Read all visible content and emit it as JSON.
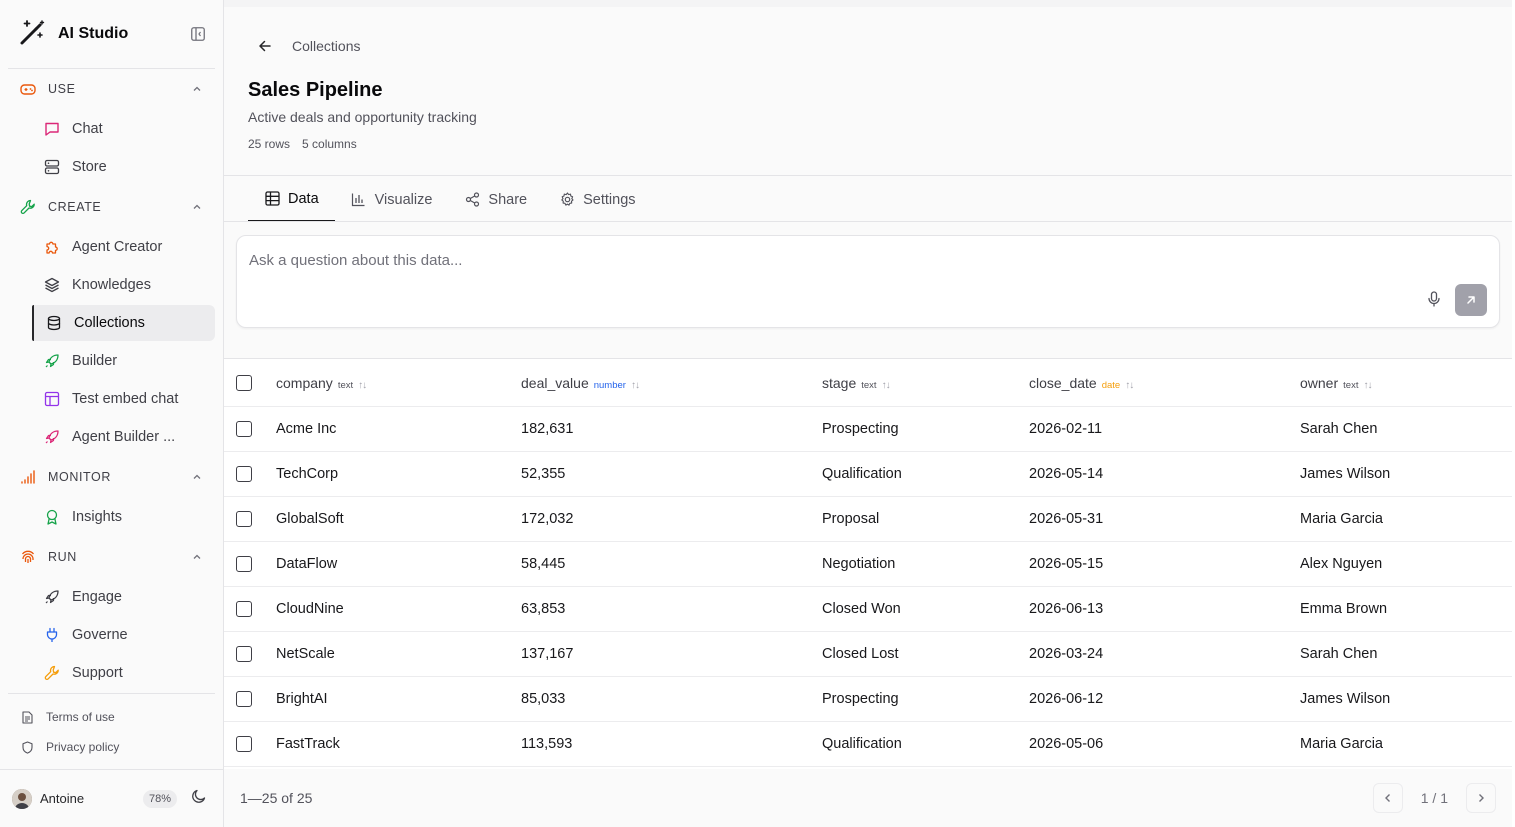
{
  "app": {
    "name": "AI Studio"
  },
  "colors": {
    "orange": "#ea580c",
    "green": "#16a34a",
    "pink": "#db2777",
    "purple": "#9333ea",
    "blue": "#2563eb",
    "amber": "#f59e0b"
  },
  "sidebar": {
    "sections": [
      {
        "label": "USE",
        "items": [
          {
            "label": "Chat",
            "icon": "message-square-icon"
          },
          {
            "label": "Store",
            "icon": "server-icon"
          }
        ]
      },
      {
        "label": "CREATE",
        "items": [
          {
            "label": "Agent Creator",
            "icon": "puzzle-icon"
          },
          {
            "label": "Knowledges",
            "icon": "layers-icon"
          },
          {
            "label": "Collections",
            "icon": "database-icon",
            "active": true
          },
          {
            "label": "Builder",
            "icon": "rocket-icon"
          },
          {
            "label": "Test embed chat",
            "icon": "layout-icon"
          },
          {
            "label": "Agent Builder ...",
            "icon": "rocket-icon"
          }
        ]
      },
      {
        "label": "MONITOR",
        "items": [
          {
            "label": "Insights",
            "icon": "award-icon"
          }
        ]
      },
      {
        "label": "RUN",
        "items": [
          {
            "label": "Engage",
            "icon": "rocket-icon"
          },
          {
            "label": "Governe",
            "icon": "plug-icon"
          },
          {
            "label": "Support",
            "icon": "wrench-icon"
          }
        ]
      }
    ],
    "legal": {
      "terms": "Terms of use",
      "privacy": "Privacy policy"
    },
    "user": {
      "name": "Antoine",
      "usage": "78%"
    }
  },
  "header": {
    "breadcrumb": "Collections",
    "title": "Sales Pipeline",
    "subtitle": "Active deals and opportunity tracking",
    "rows": "25 rows",
    "columns": "5 columns"
  },
  "tabs": [
    {
      "label": "Data",
      "icon": "table-icon"
    },
    {
      "label": "Visualize",
      "icon": "bar-chart-icon"
    },
    {
      "label": "Share",
      "icon": "share-icon"
    },
    {
      "label": "Settings",
      "icon": "gear-icon"
    }
  ],
  "ask": {
    "placeholder": "Ask a question about this data..."
  },
  "table": {
    "columns": [
      {
        "name": "company",
        "type": "text"
      },
      {
        "name": "deal_value",
        "type": "number"
      },
      {
        "name": "stage",
        "type": "text"
      },
      {
        "name": "close_date",
        "type": "date"
      },
      {
        "name": "owner",
        "type": "text"
      }
    ],
    "rows": [
      [
        "Acme Inc",
        "182,631",
        "Prospecting",
        "2026-02-11",
        "Sarah Chen"
      ],
      [
        "TechCorp",
        "52,355",
        "Qualification",
        "2026-05-14",
        "James Wilson"
      ],
      [
        "GlobalSoft",
        "172,032",
        "Proposal",
        "2026-05-31",
        "Maria Garcia"
      ],
      [
        "DataFlow",
        "58,445",
        "Negotiation",
        "2026-05-15",
        "Alex Nguyen"
      ],
      [
        "CloudNine",
        "63,853",
        "Closed Won",
        "2026-06-13",
        "Emma Brown"
      ],
      [
        "NetScale",
        "137,167",
        "Closed Lost",
        "2026-03-24",
        "Sarah Chen"
      ],
      [
        "BrightAI",
        "85,033",
        "Prospecting",
        "2026-06-12",
        "James Wilson"
      ],
      [
        "FastTrack",
        "113,593",
        "Qualification",
        "2026-05-06",
        "Maria Garcia"
      ]
    ]
  },
  "pagination": {
    "range": "1—25 of 25",
    "page": "1 / 1"
  }
}
